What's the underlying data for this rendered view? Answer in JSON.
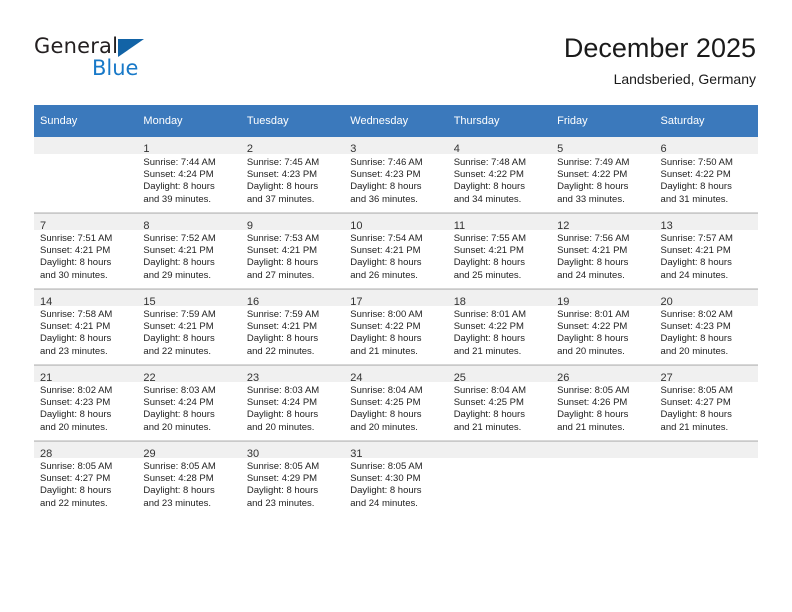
{
  "brand": {
    "word_one": "General",
    "word_two": "Blue",
    "triangle_color": "#1263a6",
    "blue_color": "#1879c8"
  },
  "header": {
    "title": "December 2025",
    "subtitle": "Landsberied, Germany"
  },
  "colors": {
    "header_row": "#3b79bc",
    "daynum_band": "#f0f0f0",
    "grid_line": "#d7d7d7"
  },
  "weekday_headers": [
    "Sunday",
    "Monday",
    "Tuesday",
    "Wednesday",
    "Thursday",
    "Friday",
    "Saturday"
  ],
  "weeks": [
    [
      {
        "day": ""
      },
      {
        "day": "1",
        "sunrise": "Sunrise: 7:44 AM",
        "sunset": "Sunset: 4:24 PM",
        "daylight1": "Daylight: 8 hours",
        "daylight2": "and 39 minutes."
      },
      {
        "day": "2",
        "sunrise": "Sunrise: 7:45 AM",
        "sunset": "Sunset: 4:23 PM",
        "daylight1": "Daylight: 8 hours",
        "daylight2": "and 37 minutes."
      },
      {
        "day": "3",
        "sunrise": "Sunrise: 7:46 AM",
        "sunset": "Sunset: 4:23 PM",
        "daylight1": "Daylight: 8 hours",
        "daylight2": "and 36 minutes."
      },
      {
        "day": "4",
        "sunrise": "Sunrise: 7:48 AM",
        "sunset": "Sunset: 4:22 PM",
        "daylight1": "Daylight: 8 hours",
        "daylight2": "and 34 minutes."
      },
      {
        "day": "5",
        "sunrise": "Sunrise: 7:49 AM",
        "sunset": "Sunset: 4:22 PM",
        "daylight1": "Daylight: 8 hours",
        "daylight2": "and 33 minutes."
      },
      {
        "day": "6",
        "sunrise": "Sunrise: 7:50 AM",
        "sunset": "Sunset: 4:22 PM",
        "daylight1": "Daylight: 8 hours",
        "daylight2": "and 31 minutes."
      }
    ],
    [
      {
        "day": "7",
        "sunrise": "Sunrise: 7:51 AM",
        "sunset": "Sunset: 4:21 PM",
        "daylight1": "Daylight: 8 hours",
        "daylight2": "and 30 minutes."
      },
      {
        "day": "8",
        "sunrise": "Sunrise: 7:52 AM",
        "sunset": "Sunset: 4:21 PM",
        "daylight1": "Daylight: 8 hours",
        "daylight2": "and 29 minutes."
      },
      {
        "day": "9",
        "sunrise": "Sunrise: 7:53 AM",
        "sunset": "Sunset: 4:21 PM",
        "daylight1": "Daylight: 8 hours",
        "daylight2": "and 27 minutes."
      },
      {
        "day": "10",
        "sunrise": "Sunrise: 7:54 AM",
        "sunset": "Sunset: 4:21 PM",
        "daylight1": "Daylight: 8 hours",
        "daylight2": "and 26 minutes."
      },
      {
        "day": "11",
        "sunrise": "Sunrise: 7:55 AM",
        "sunset": "Sunset: 4:21 PM",
        "daylight1": "Daylight: 8 hours",
        "daylight2": "and 25 minutes."
      },
      {
        "day": "12",
        "sunrise": "Sunrise: 7:56 AM",
        "sunset": "Sunset: 4:21 PM",
        "daylight1": "Daylight: 8 hours",
        "daylight2": "and 24 minutes."
      },
      {
        "day": "13",
        "sunrise": "Sunrise: 7:57 AM",
        "sunset": "Sunset: 4:21 PM",
        "daylight1": "Daylight: 8 hours",
        "daylight2": "and 24 minutes."
      }
    ],
    [
      {
        "day": "14",
        "sunrise": "Sunrise: 7:58 AM",
        "sunset": "Sunset: 4:21 PM",
        "daylight1": "Daylight: 8 hours",
        "daylight2": "and 23 minutes."
      },
      {
        "day": "15",
        "sunrise": "Sunrise: 7:59 AM",
        "sunset": "Sunset: 4:21 PM",
        "daylight1": "Daylight: 8 hours",
        "daylight2": "and 22 minutes."
      },
      {
        "day": "16",
        "sunrise": "Sunrise: 7:59 AM",
        "sunset": "Sunset: 4:21 PM",
        "daylight1": "Daylight: 8 hours",
        "daylight2": "and 22 minutes."
      },
      {
        "day": "17",
        "sunrise": "Sunrise: 8:00 AM",
        "sunset": "Sunset: 4:22 PM",
        "daylight1": "Daylight: 8 hours",
        "daylight2": "and 21 minutes."
      },
      {
        "day": "18",
        "sunrise": "Sunrise: 8:01 AM",
        "sunset": "Sunset: 4:22 PM",
        "daylight1": "Daylight: 8 hours",
        "daylight2": "and 21 minutes."
      },
      {
        "day": "19",
        "sunrise": "Sunrise: 8:01 AM",
        "sunset": "Sunset: 4:22 PM",
        "daylight1": "Daylight: 8 hours",
        "daylight2": "and 20 minutes."
      },
      {
        "day": "20",
        "sunrise": "Sunrise: 8:02 AM",
        "sunset": "Sunset: 4:23 PM",
        "daylight1": "Daylight: 8 hours",
        "daylight2": "and 20 minutes."
      }
    ],
    [
      {
        "day": "21",
        "sunrise": "Sunrise: 8:02 AM",
        "sunset": "Sunset: 4:23 PM",
        "daylight1": "Daylight: 8 hours",
        "daylight2": "and 20 minutes."
      },
      {
        "day": "22",
        "sunrise": "Sunrise: 8:03 AM",
        "sunset": "Sunset: 4:24 PM",
        "daylight1": "Daylight: 8 hours",
        "daylight2": "and 20 minutes."
      },
      {
        "day": "23",
        "sunrise": "Sunrise: 8:03 AM",
        "sunset": "Sunset: 4:24 PM",
        "daylight1": "Daylight: 8 hours",
        "daylight2": "and 20 minutes."
      },
      {
        "day": "24",
        "sunrise": "Sunrise: 8:04 AM",
        "sunset": "Sunset: 4:25 PM",
        "daylight1": "Daylight: 8 hours",
        "daylight2": "and 20 minutes."
      },
      {
        "day": "25",
        "sunrise": "Sunrise: 8:04 AM",
        "sunset": "Sunset: 4:25 PM",
        "daylight1": "Daylight: 8 hours",
        "daylight2": "and 21 minutes."
      },
      {
        "day": "26",
        "sunrise": "Sunrise: 8:05 AM",
        "sunset": "Sunset: 4:26 PM",
        "daylight1": "Daylight: 8 hours",
        "daylight2": "and 21 minutes."
      },
      {
        "day": "27",
        "sunrise": "Sunrise: 8:05 AM",
        "sunset": "Sunset: 4:27 PM",
        "daylight1": "Daylight: 8 hours",
        "daylight2": "and 21 minutes."
      }
    ],
    [
      {
        "day": "28",
        "sunrise": "Sunrise: 8:05 AM",
        "sunset": "Sunset: 4:27 PM",
        "daylight1": "Daylight: 8 hours",
        "daylight2": "and 22 minutes."
      },
      {
        "day": "29",
        "sunrise": "Sunrise: 8:05 AM",
        "sunset": "Sunset: 4:28 PM",
        "daylight1": "Daylight: 8 hours",
        "daylight2": "and 23 minutes."
      },
      {
        "day": "30",
        "sunrise": "Sunrise: 8:05 AM",
        "sunset": "Sunset: 4:29 PM",
        "daylight1": "Daylight: 8 hours",
        "daylight2": "and 23 minutes."
      },
      {
        "day": "31",
        "sunrise": "Sunrise: 8:05 AM",
        "sunset": "Sunset: 4:30 PM",
        "daylight1": "Daylight: 8 hours",
        "daylight2": "and 24 minutes."
      },
      {
        "day": ""
      },
      {
        "day": ""
      },
      {
        "day": ""
      }
    ]
  ]
}
